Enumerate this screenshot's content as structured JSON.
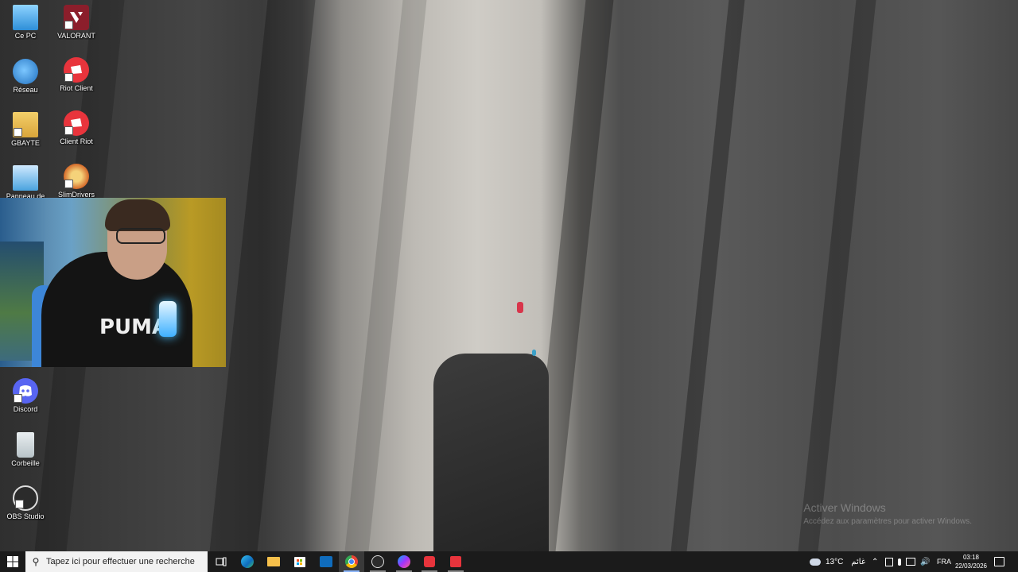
{
  "desktop": {
    "icons": [
      {
        "label": "Ce PC",
        "icon": "computer-icon",
        "color": "#5fb8e8"
      },
      {
        "label": "VALORANT",
        "icon": "valorant-icon",
        "color": "#8b1e2b"
      },
      {
        "label": "Réseau",
        "icon": "network-icon",
        "color": "#2f8fd8"
      },
      {
        "label": "Riot Client",
        "icon": "riot-client-icon",
        "color": "#e8343c"
      },
      {
        "label": "GBAYTE",
        "icon": "folder-icon",
        "color": "#e8b84a"
      },
      {
        "label": "Client Riot",
        "icon": "riot-client-icon",
        "color": "#e8343c"
      },
      {
        "label": "Panneau de",
        "icon": "control-panel-icon",
        "color": "#4aa3df"
      },
      {
        "label": "SlimDrivers",
        "icon": "slimdrivers-icon",
        "color": "#d46a2a"
      },
      {
        "label": "Discord",
        "icon": "discord-icon",
        "color": "#5865f2"
      },
      {
        "label": "Corbeille",
        "icon": "recycle-bin-icon",
        "color": "#cfd8dc"
      },
      {
        "label": "OBS Studio",
        "icon": "obs-icon",
        "color": "#2b2b2b"
      }
    ],
    "watermark": {
      "title": "Activer Windows",
      "subtitle": "Accédez aux paramètres pour activer Windows."
    },
    "webcam": {
      "shirt_text": "PUMA"
    }
  },
  "taskbar": {
    "search_placeholder": "Tapez ici pour effectuer une recherche",
    "apps": [
      "task-view-icon",
      "edge-icon",
      "file-explorer-icon",
      "store-icon",
      "outlook-icon",
      "chrome-icon",
      "obs-icon",
      "messenger-icon",
      "riot-client-icon",
      "valorant-icon"
    ],
    "weather_temp": "13°C",
    "weather_text": "غائم",
    "language": "FRA",
    "time": "03:18",
    "date": "22/03/2026"
  }
}
